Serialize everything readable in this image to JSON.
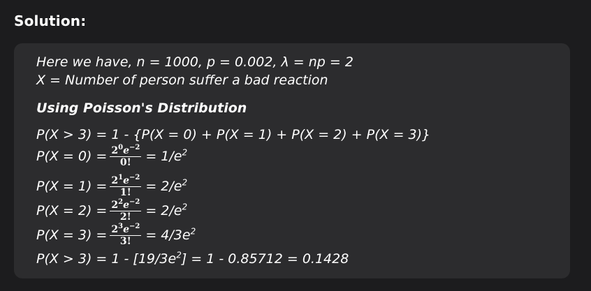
{
  "heading": "Solution:",
  "given_line": "Here we have, n = 1000, p = 0.002, λ = np = 2",
  "x_definition": "X = Number of person suffer a bad reaction",
  "method_label": "Using Poisson's Distribution",
  "formula_line": "P(X > 3) = 1 - {P(X = 0) + P(X = 1) + P(X = 2) + P(X = 3)}",
  "terms": [
    {
      "lhs": "P(X = 0) =",
      "num_base": "2",
      "num_exp": "0",
      "num_e": "e",
      "num_e_exp": "−2",
      "den": "0!",
      "rhs": "= 1/e",
      "rhs_exp": "2"
    },
    {
      "lhs": "P(X = 1) =",
      "num_base": "2",
      "num_exp": "1",
      "num_e": "e",
      "num_e_exp": "−2",
      "den": "1!",
      "rhs": "= 2/e",
      "rhs_exp": "2"
    },
    {
      "lhs": "P(X = 2) =",
      "num_base": "2",
      "num_exp": "2",
      "num_e": "e",
      "num_e_exp": "−2",
      "den": "2!",
      "rhs": "= 2/e",
      "rhs_exp": "2"
    },
    {
      "lhs": "P(X = 3) =",
      "num_base": "2",
      "num_exp": "3",
      "num_e": "e",
      "num_e_exp": "−2",
      "den": "3!",
      "rhs": "= 4/3e",
      "rhs_exp": "2"
    }
  ],
  "final": {
    "pre": "P(X > 3) = 1 - [19/3e",
    "exp": "2",
    "post": "] = 1 - 0.85712 = 0.1428"
  }
}
